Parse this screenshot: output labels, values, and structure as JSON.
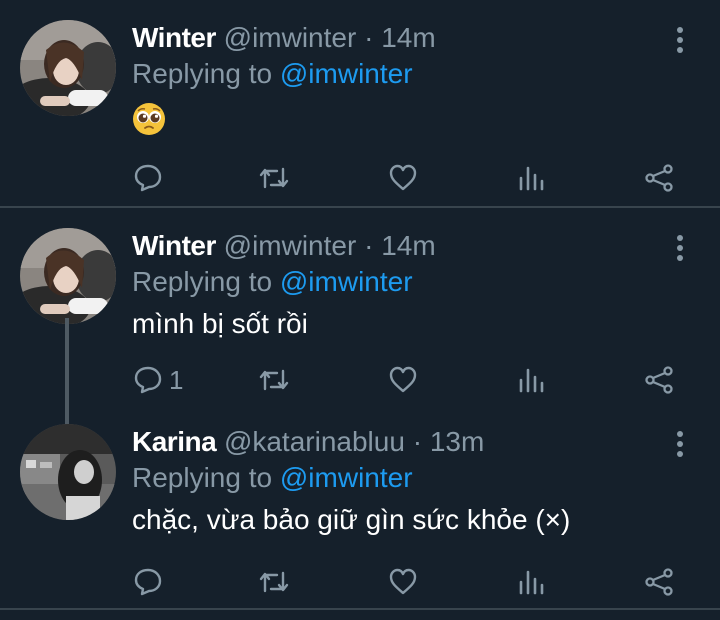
{
  "tweets": [
    {
      "name": "Winter",
      "handle": "@imwinter",
      "separator": "·",
      "time": "14m",
      "replying_prefix": "Replying to",
      "replying_to": "@imwinter",
      "text": "",
      "emoji": "pleading-face",
      "reply_count": ""
    },
    {
      "name": "Winter",
      "handle": "@imwinter",
      "separator": "·",
      "time": "14m",
      "replying_prefix": "Replying to",
      "replying_to": "@imwinter",
      "text": "mình bị sốt rồi",
      "reply_count": "1"
    },
    {
      "name": "Karina",
      "handle": "@katarinabluu",
      "separator": "·",
      "time": "13m",
      "replying_prefix": "Replying to",
      "replying_to": "@imwinter",
      "text": "chặc, vừa bảo giữ gìn sức khỏe (×)",
      "reply_count": ""
    }
  ],
  "colors": {
    "background": "#15202b",
    "divider": "#38444d",
    "secondary_text": "#8899a6",
    "accent": "#1d9bf0"
  },
  "icons": [
    "reply-icon",
    "retweet-icon",
    "like-icon",
    "stats-icon",
    "share-icon",
    "more-options-icon"
  ]
}
